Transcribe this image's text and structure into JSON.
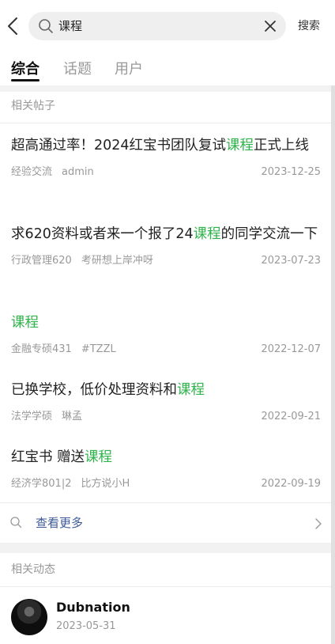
{
  "search": {
    "query": "课程",
    "submit_label": "搜索"
  },
  "tabs": [
    {
      "label": "综合",
      "active": true
    },
    {
      "label": "话题",
      "active": false
    },
    {
      "label": "用户",
      "active": false
    }
  ],
  "related_posts": {
    "section_title": "相关帖子",
    "posts": [
      {
        "title_before": "超高通过率！2024红宝书团队复试",
        "title_highlight": "课程",
        "title_after": "正式上线",
        "category": "经验交流",
        "author": "admin",
        "date": "2023-12-25"
      },
      {
        "title_before": "求620资料或者来一个报了24",
        "title_highlight": "课程",
        "title_after": "的同学交流一下",
        "category": "行政管理620",
        "author": "考研想上岸冲呀",
        "date": "2023-07-23"
      },
      {
        "title_before": "",
        "title_highlight": "课程",
        "title_after": "",
        "category": "金融专硕431",
        "author": "#TZZL",
        "date": "2022-12-07"
      },
      {
        "title_before": "已换学校，低价处理资料和",
        "title_highlight": "课程",
        "title_after": "",
        "category": "法学学硕",
        "author": "琳孟",
        "date": "2022-09-21"
      },
      {
        "title_before": "红宝书 赠送",
        "title_highlight": "课程",
        "title_after": "",
        "category": "经济学801|2",
        "author": "比方说小H",
        "date": "2022-09-19"
      }
    ],
    "more_label": "查看更多"
  },
  "related_activity": {
    "section_title": "相关动态",
    "items": [
      {
        "user": "Dubnation",
        "date": "2023-05-31"
      }
    ]
  },
  "colors": {
    "highlight": "#2fb34b",
    "link": "#3d5a9a",
    "background": "#f2f2f2"
  },
  "icons": [
    "back-arrow-icon",
    "search-icon",
    "clear-icon",
    "chevron-right-icon"
  ]
}
